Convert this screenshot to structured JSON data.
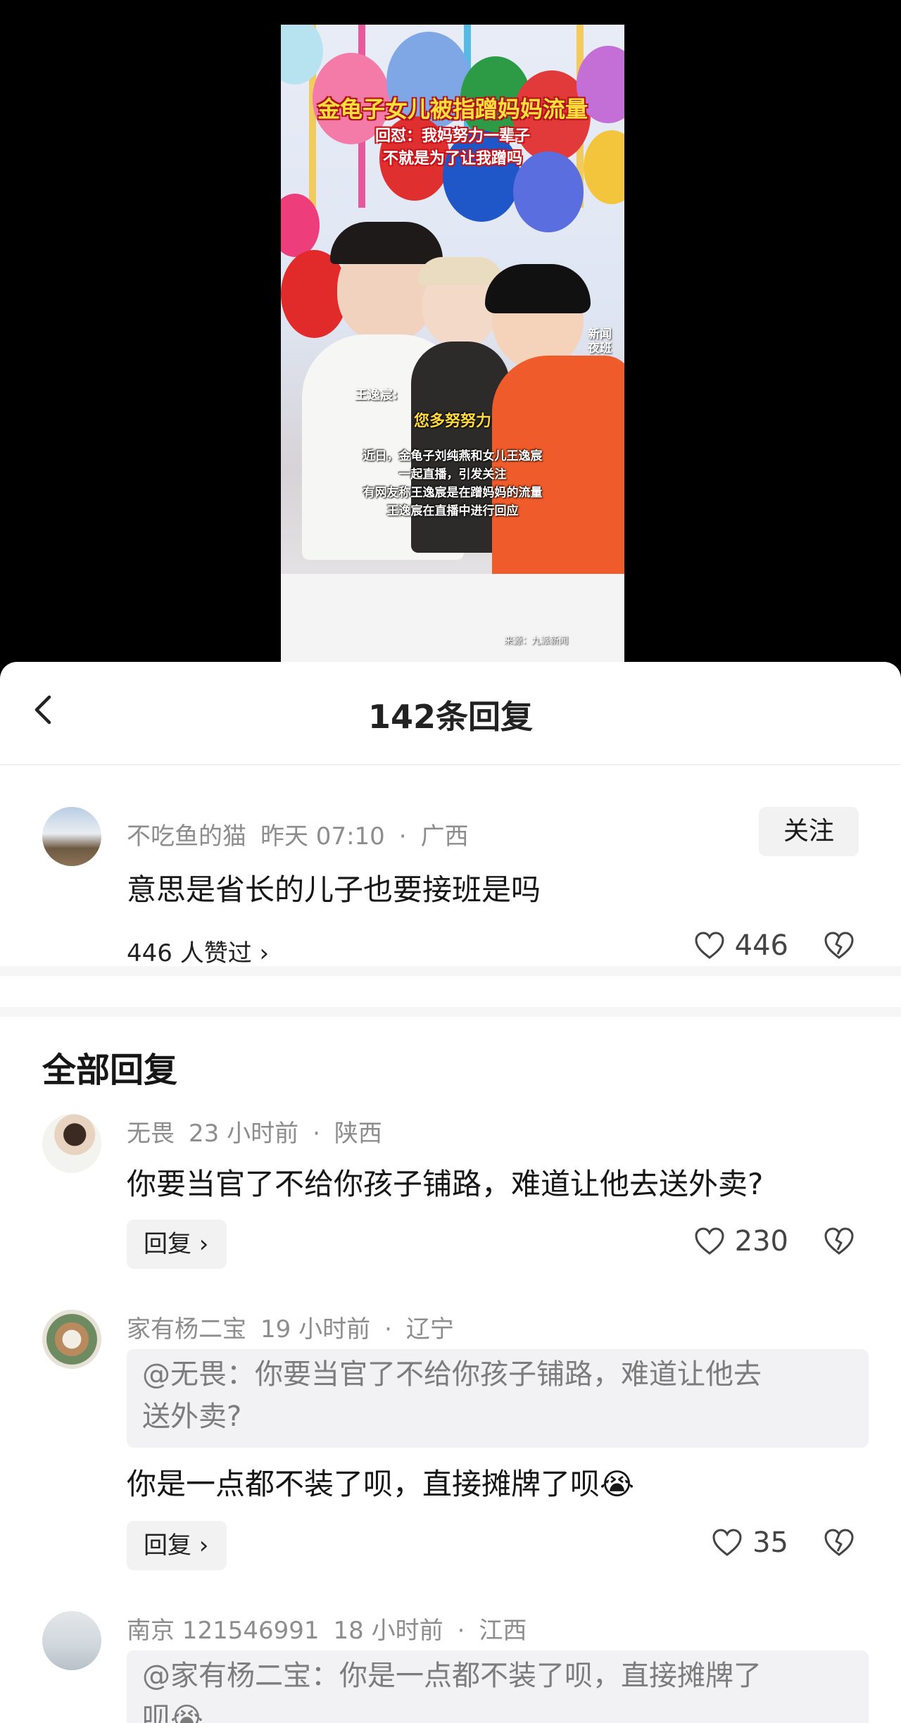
{
  "video": {
    "overlay_title": "金龟子女儿被指蹭妈妈流量",
    "overlay_sub1": "回怼：我妈努力一辈子",
    "overlay_sub2": "不就是为了让我蹭吗",
    "speaker": "王逸宸:",
    "quote": "您多努努力",
    "caption": [
      "近日，金龟子刘纯燕和女儿王逸宸",
      "一起直播，引发关注",
      "有网友称王逸宸是在蹭妈妈的流量",
      "王逸宸在直播中进行回应"
    ],
    "logo": "新闻夜班",
    "source": "来源：九派新闻"
  },
  "sheet": {
    "title": "142条回复",
    "root": {
      "username": "不吃鱼的猫",
      "time": "昨天 07:10",
      "region": "广西",
      "follow_label": "关注",
      "text": "意思是省长的儿子也要接班是吗",
      "likers": "446 人赞过 ›",
      "like_count": "446"
    },
    "section_title": "全部回复",
    "replies": [
      {
        "username": "无畏",
        "time": "23 小时前",
        "region": "陕西",
        "text": "你要当官了不给你孩子铺路，难道让他去送外卖?",
        "reply_label": "回复",
        "like_count": "230"
      },
      {
        "username": "家有杨二宝",
        "time": "19 小时前",
        "region": "辽宁",
        "quote_line1": "@无畏：你要当官了不给你孩子铺路，难道让他去",
        "quote_line2": "送外卖?",
        "text": "你是一点都不装了呗，直接摊牌了呗😭",
        "reply_label": "回复",
        "like_count": "35"
      },
      {
        "username": "南京 121546991",
        "time": "18 小时前",
        "region": "江西",
        "quote_line1": "@家有杨二宝：你是一点都不装了呗，直接摊牌了",
        "quote_line2": "呗😭"
      }
    ]
  },
  "colors": {
    "accent_text": "#161616",
    "meta_gray": "#8d8d8d",
    "pill_bg": "#f2f2f2"
  }
}
